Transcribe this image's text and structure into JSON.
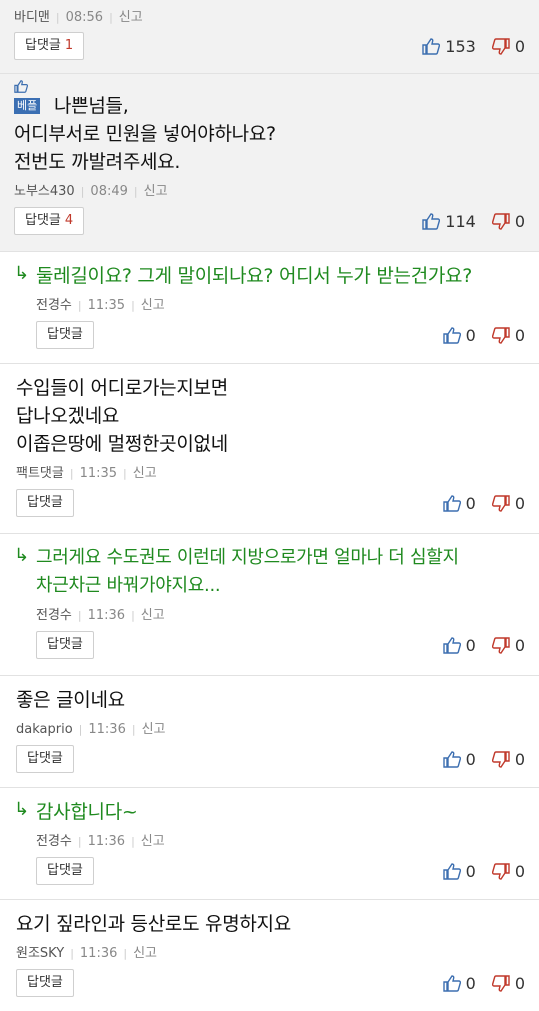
{
  "labels": {
    "report": "신고",
    "reply_button": "답댓글",
    "best": "베플"
  },
  "colors": {
    "reply_text": "#1f8a1f",
    "best_badge": "#3b6fb3",
    "thumb_up": "#3d6fb0",
    "thumb_down": "#c0392b"
  },
  "comments": [
    {
      "author": "바디맨",
      "time": "08:56",
      "reply_count": "1",
      "likes": "153",
      "dislikes": "0"
    },
    {
      "text": "나쁜넘들,\n어디부서로 민원을 넣어야하나요?\n전번도 까발려주세요.",
      "author": "노부스430",
      "time": "08:49",
      "reply_count": "4",
      "likes": "114",
      "dislikes": "0"
    },
    {
      "text": "둘레길이요? 그게 말이되나요? 어디서 누가 받는건가요?",
      "author": "전경수",
      "time": "11:35",
      "likes": "0",
      "dislikes": "0"
    },
    {
      "text": "수입들이 어디로가는지보면\n답나오겠네요\n이좁은땅에 멀쩡한곳이없네",
      "author": "팩트댓글",
      "time": "11:35",
      "likes": "0",
      "dislikes": "0"
    },
    {
      "text": "그러게요 수도권도 이런데 지방으로가면 얼마나 더 심할지\n차근차근 바꿔가야지요...",
      "author": "전경수",
      "time": "11:36",
      "likes": "0",
      "dislikes": "0"
    },
    {
      "text": "좋은 글이네요",
      "author": "dakaprio",
      "time": "11:36",
      "likes": "0",
      "dislikes": "0"
    },
    {
      "text": "감사합니다~",
      "author": "전경수",
      "time": "11:36",
      "likes": "0",
      "dislikes": "0"
    },
    {
      "text": "요기 짚라인과 등산로도 유명하지요",
      "author": "원조SKY",
      "time": "11:36",
      "likes": "0",
      "dislikes": "0"
    }
  ]
}
